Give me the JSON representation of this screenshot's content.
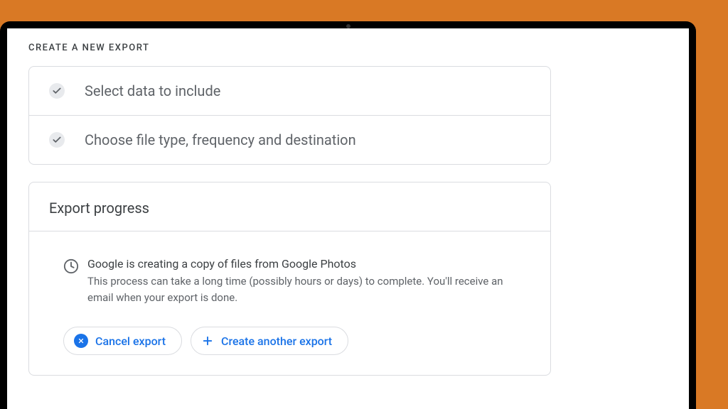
{
  "page": {
    "title": "CREATE A NEW EXPORT"
  },
  "steps": {
    "step1_label": "Select data to include",
    "step2_label": "Choose file type, frequency and destination"
  },
  "progress": {
    "card_title": "Export progress",
    "main_text": "Google is creating a copy of files from Google Photos",
    "sub_text": "This process can take a long time (possibly hours or days) to complete. You'll receive an email when your export is done."
  },
  "buttons": {
    "cancel_label": "Cancel export",
    "create_another_label": "Create another export"
  }
}
